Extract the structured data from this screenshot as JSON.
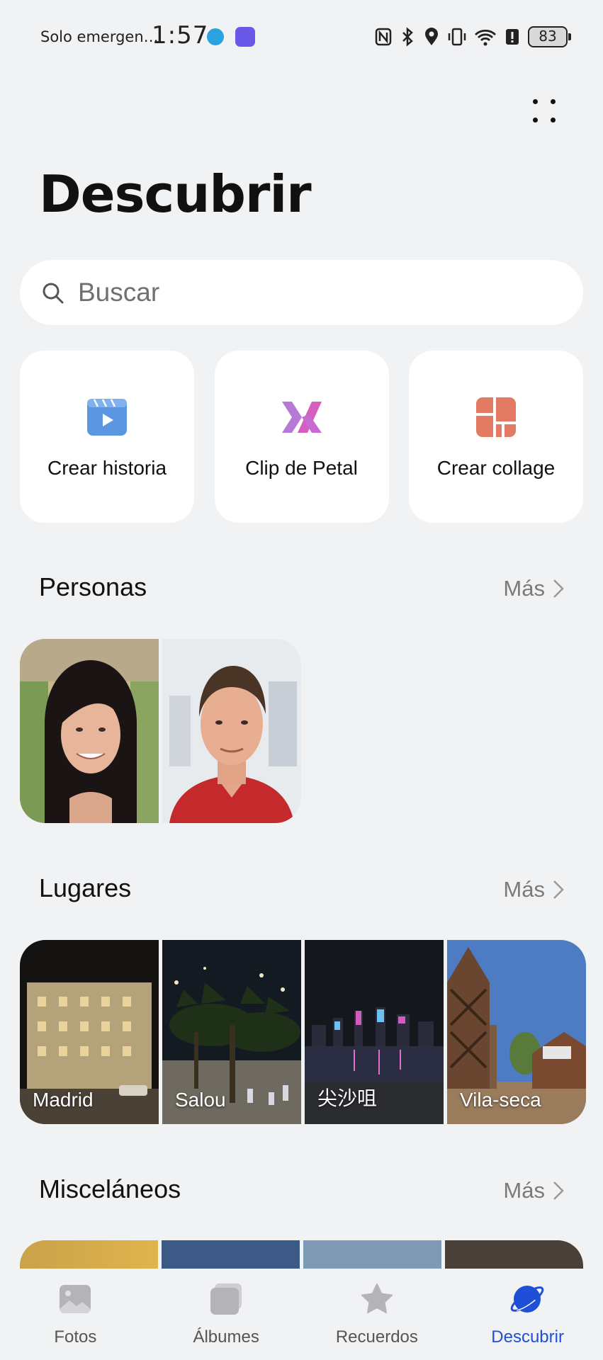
{
  "status_bar": {
    "carrier": "Solo emergen…",
    "time": "1:57",
    "battery": "83",
    "icons": [
      "telegram-icon",
      "app-store-icon",
      "nfc-icon",
      "bluetooth-icon",
      "location-icon",
      "vibrate-icon",
      "wifi-icon",
      "alert-icon",
      "battery-icon"
    ]
  },
  "header": {
    "title": "Descubrir"
  },
  "search": {
    "placeholder": "Buscar"
  },
  "tools": [
    {
      "label": "Crear historia",
      "icon": "story-icon",
      "color": "#4a90d9"
    },
    {
      "label": "Clip de Petal",
      "icon": "petal-clip-icon",
      "color": "#c06bd0"
    },
    {
      "label": "Crear collage",
      "icon": "collage-icon",
      "color": "#e0735a"
    }
  ],
  "sections": {
    "personas": {
      "title": "Personas",
      "more": "Más"
    },
    "lugares": {
      "title": "Lugares",
      "more": "Más",
      "places": [
        "Madrid",
        "Salou",
        "尖沙咀",
        "Vila-seca"
      ]
    },
    "miscelaneos": {
      "title": "Misceláneos",
      "more": "Más"
    }
  },
  "bottom_nav": {
    "items": [
      {
        "label": "Fotos",
        "icon": "photos-icon"
      },
      {
        "label": "Álbumes",
        "icon": "albums-icon"
      },
      {
        "label": "Recuerdos",
        "icon": "memories-star-icon"
      },
      {
        "label": "Descubrir",
        "icon": "discover-planet-icon",
        "active": true
      }
    ],
    "active_color": "#1f4fd6"
  }
}
